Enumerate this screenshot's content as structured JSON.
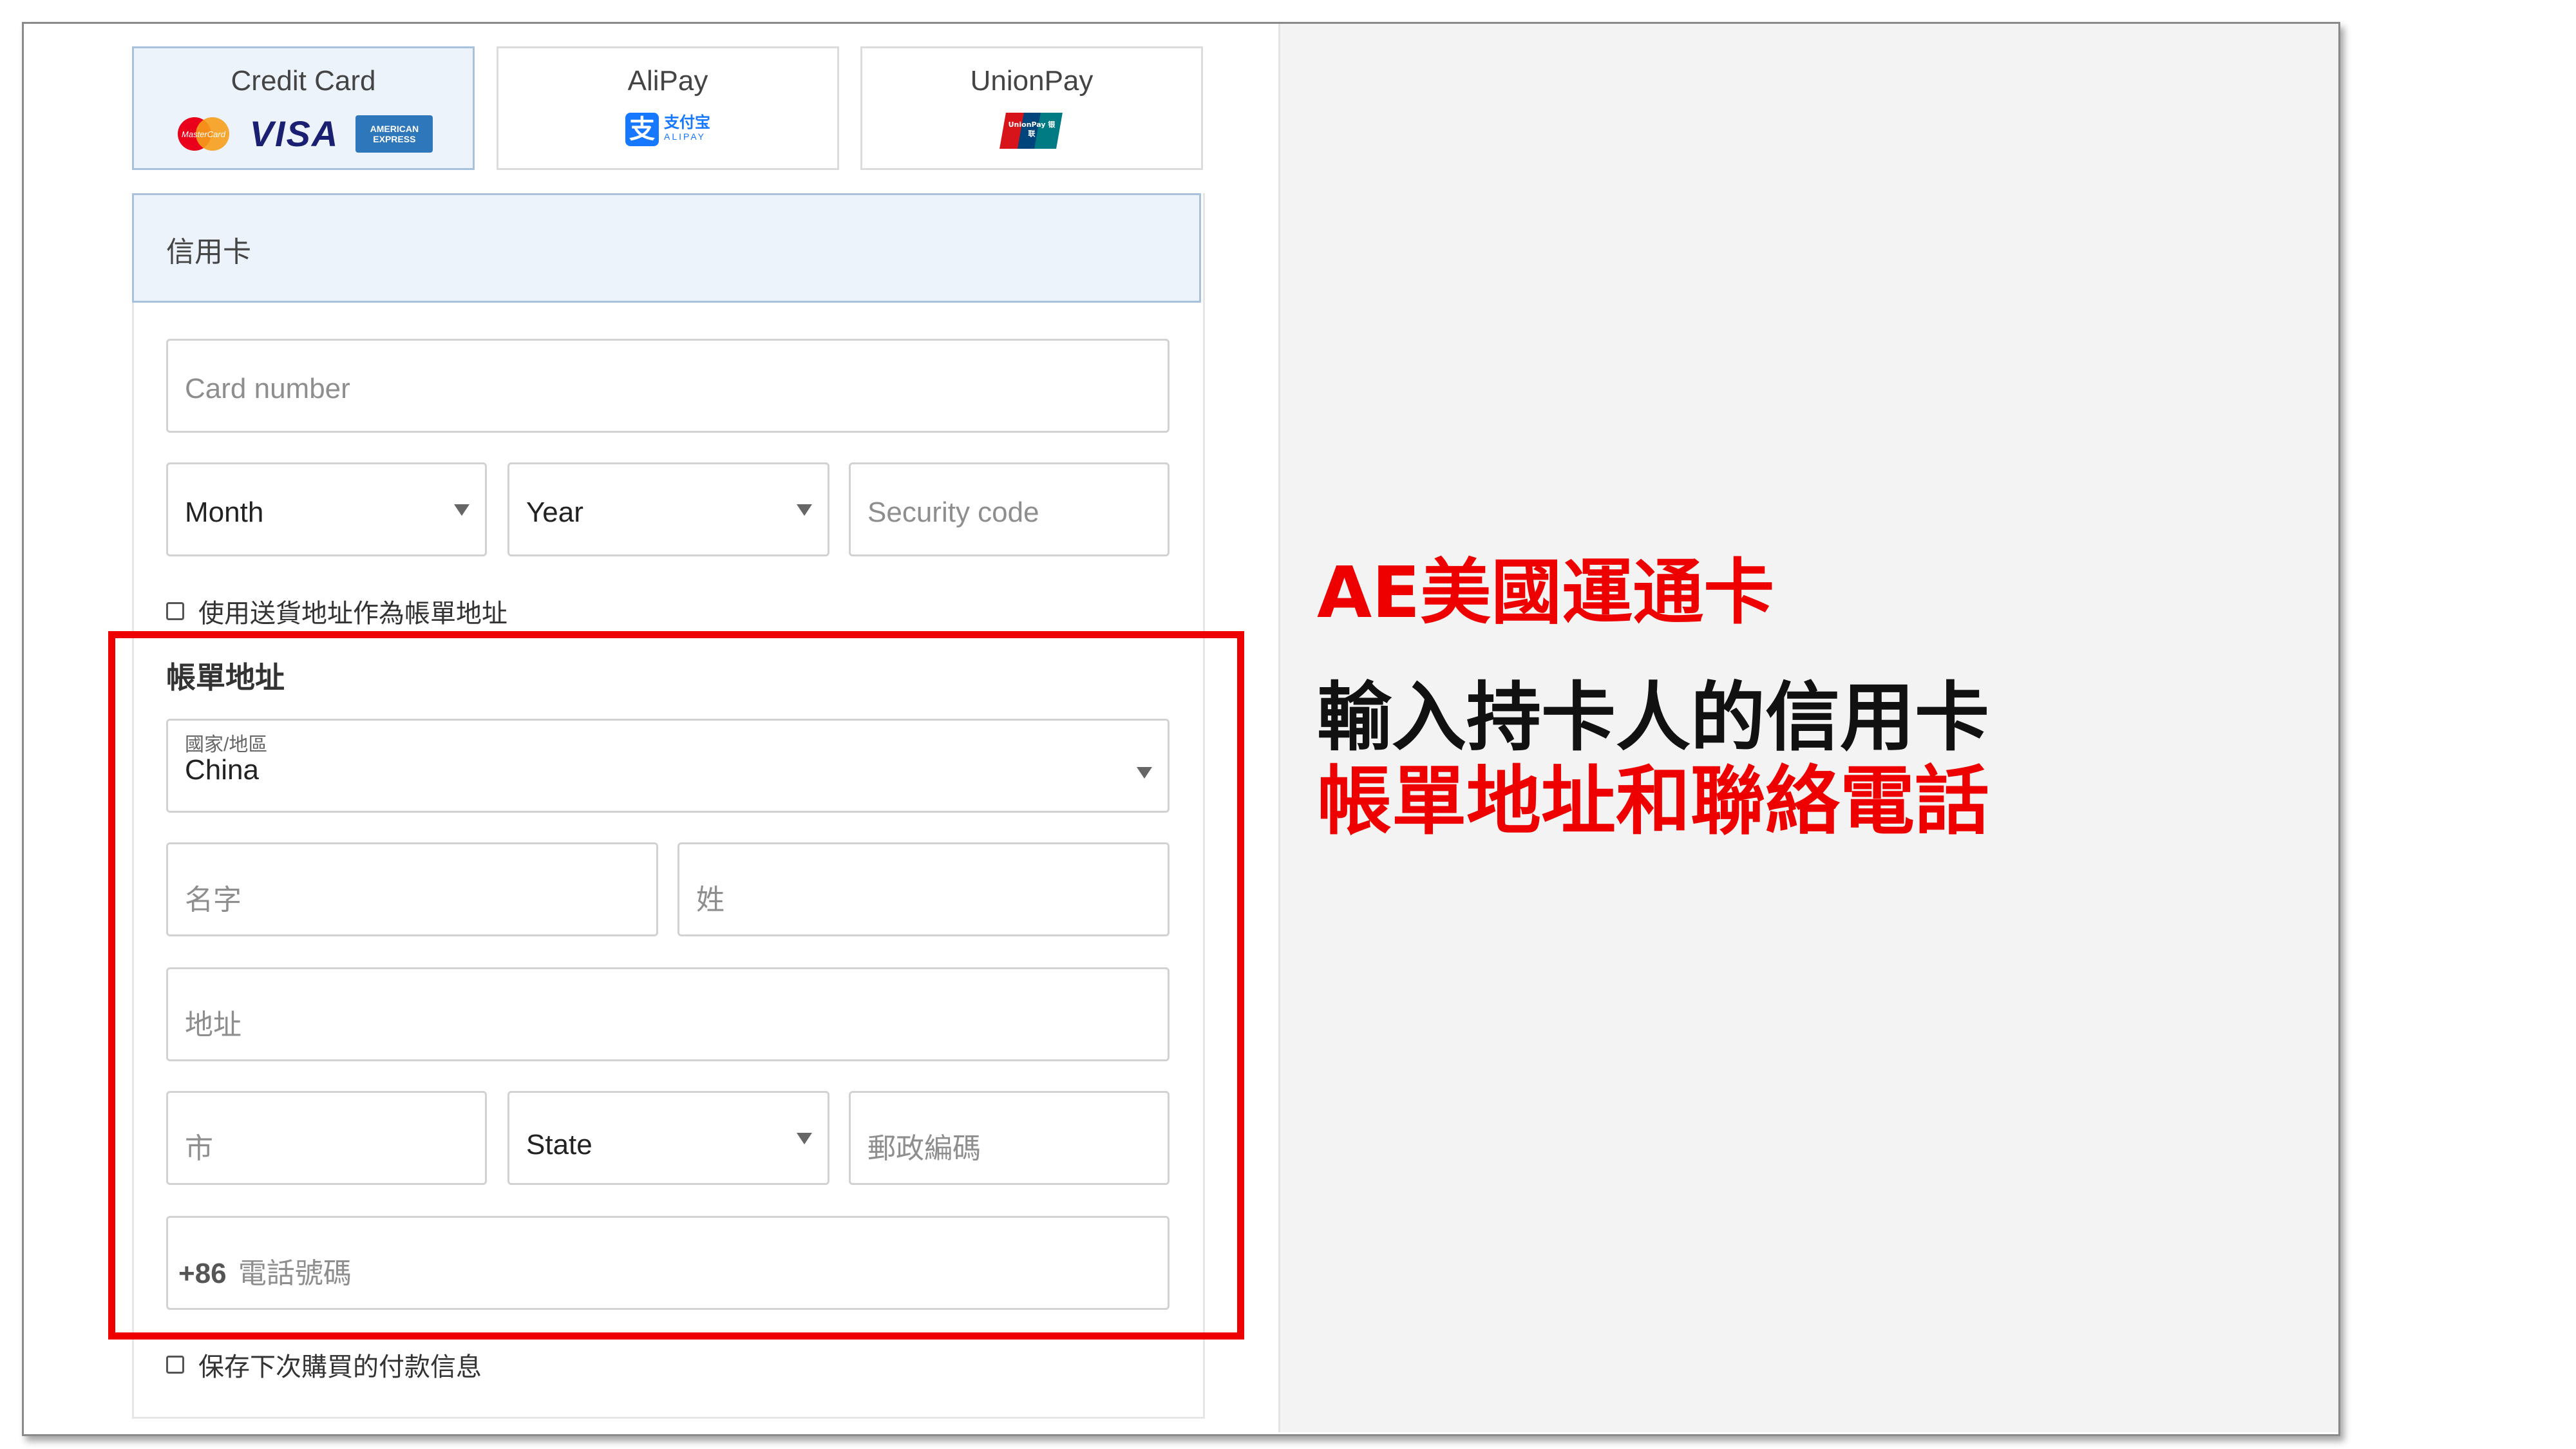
{
  "payment_methods": [
    {
      "label": "Credit Card",
      "active": true,
      "logos": [
        "mastercard-logo",
        "visa-logo",
        "amex-logo"
      ],
      "visa_text": "VISA",
      "amex_text": "AMERICAN EXPRESS"
    },
    {
      "label": "AliPay",
      "active": false,
      "logos": [
        "alipay-logo"
      ],
      "alipay_text": "支付宝",
      "alipay_sub": "ALIPAY"
    },
    {
      "label": "UnionPay",
      "active": false,
      "logos": [
        "unionpay-logo"
      ],
      "unionpay_text": "UnionPay 银联"
    }
  ],
  "section_title": "信用卡",
  "card": {
    "number_placeholder": "Card number",
    "month_value": "Month",
    "year_value": "Year",
    "security_placeholder": "Security code"
  },
  "use_shipping_label": "使用送貨地址作為帳單地址",
  "billing": {
    "title": "帳單地址",
    "country_label": "國家/地區",
    "country_value": "China",
    "first_name_placeholder": "名字",
    "last_name_placeholder": "姓",
    "address_placeholder": "地址",
    "city_placeholder": "市",
    "state_value": "State",
    "postal_placeholder": "郵政編碼",
    "phone_prefix": "+86",
    "phone_placeholder": "電話號碼"
  },
  "save_payment_label": "保存下次購買的付款信息",
  "annotation": {
    "title": "AE美國運通卡",
    "line1": "輸入持卡人的信用卡",
    "line2": "帳單地址和聯絡電話"
  },
  "colors": {
    "highlight_red": "#ee0000",
    "active_tab_bg": "#ecf3fb"
  }
}
